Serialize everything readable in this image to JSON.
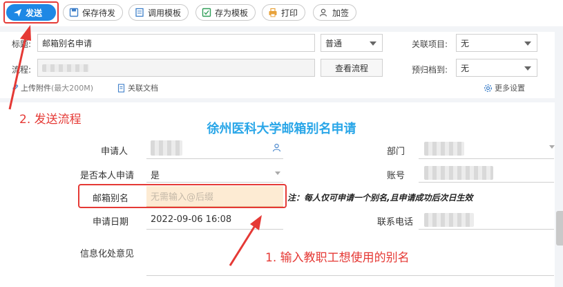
{
  "toolbar": {
    "send": "发送",
    "save_draft": "保存待发",
    "use_template": "调用模板",
    "save_template": "存为模板",
    "print": "打印",
    "countersign": "加签"
  },
  "header": {
    "title_label": "标题:",
    "title_value": "邮箱别名申请",
    "priority": "普通",
    "related_project_label": "关联项目:",
    "related_project_value": "无",
    "flow_label": "流程:",
    "view_flow": "查看流程",
    "archive_label": "预归档到:",
    "archive_value": "无",
    "upload_attachment": "上传附件",
    "upload_limit": "(最大200M)",
    "related_doc": "关联文档",
    "more_settings": "更多设置"
  },
  "form": {
    "title": "徐州医科大学邮箱别名申请",
    "applicant_label": "申请人",
    "department_label": "部门",
    "self_apply_label": "是否本人申请",
    "self_apply_value": "是",
    "account_label": "账号",
    "alias_label": "邮箱别名",
    "alias_placeholder": "无需输入@后缀",
    "note": "注：每人仅可申请一个别名,且申请成功后次日生效",
    "date_label": "申请日期",
    "date_value": "2022-09-06 16:08",
    "phone_label": "联系电话",
    "opinion_label": "信息化处意见"
  },
  "annotations": {
    "step1": "1. 输入教职工想使用的别名",
    "step2": "2. 发送流程"
  },
  "colors": {
    "send_button": "#1e88e5",
    "form_title": "#29a6e8",
    "annotation": "#e53935",
    "alias_field_bg": "#fdebd3"
  },
  "icons": {
    "send": "paper-plane-icon",
    "save_draft": "save-icon",
    "use_template": "template-icon",
    "save_template": "save-template-icon",
    "print": "printer-icon",
    "countersign": "add-people-icon",
    "applicant": "person-icon",
    "upload": "paperclip-icon",
    "related_doc": "document-icon",
    "more_settings": "gear-icon"
  }
}
